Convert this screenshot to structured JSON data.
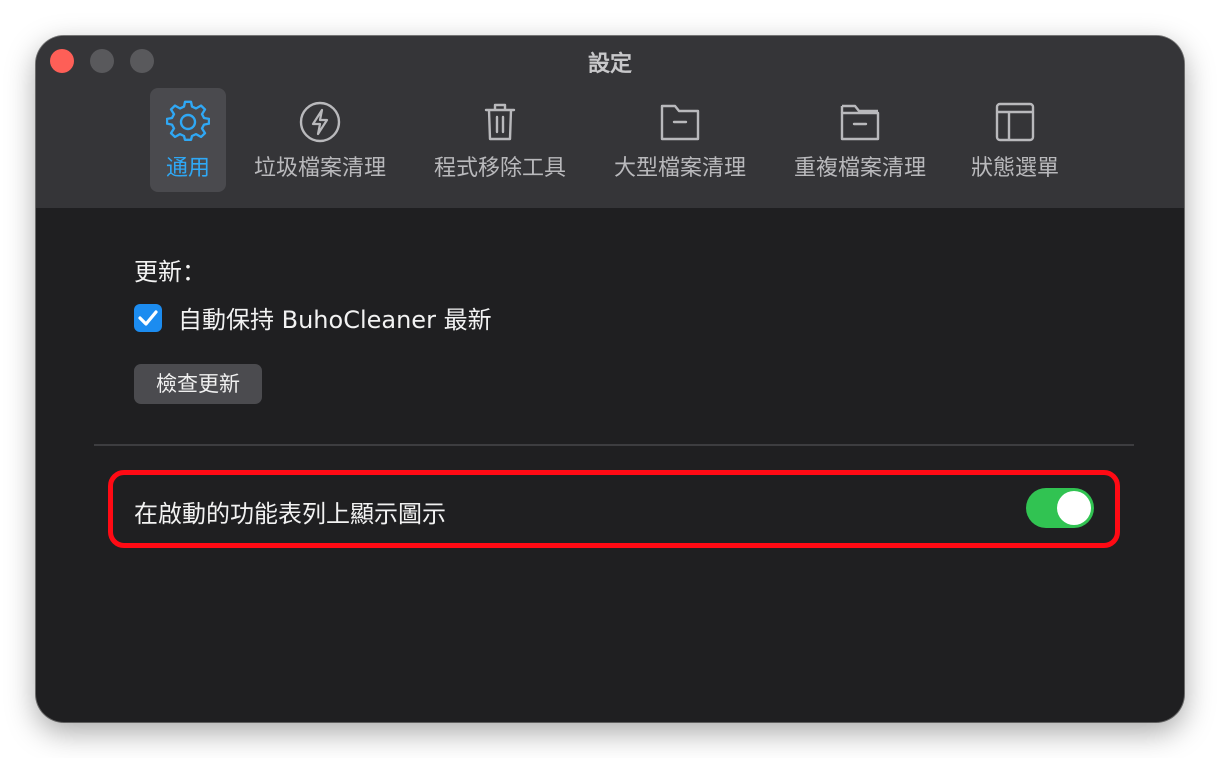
{
  "window": {
    "title": "設定"
  },
  "tabs": [
    {
      "label": "通用",
      "icon": "gear-icon",
      "active": true
    },
    {
      "label": "垃圾檔案清理",
      "icon": "lightning-icon",
      "active": false
    },
    {
      "label": "程式移除工具",
      "icon": "trash-icon",
      "active": false
    },
    {
      "label": "大型檔案清理",
      "icon": "folder-icon",
      "active": false
    },
    {
      "label": "重複檔案清理",
      "icon": "folder-stack-icon",
      "active": false
    },
    {
      "label": "狀態選單",
      "icon": "panel-layout-icon",
      "active": false
    }
  ],
  "update": {
    "section_label": "更新：",
    "auto_update_label": "自動保持 BuhoCleaner 最新",
    "auto_update_checked": true,
    "check_button_label": "檢查更新"
  },
  "menubar": {
    "toggle_label": "在啟動的功能表列上顯示圖示",
    "toggle_on": true
  },
  "colors": {
    "accent": "#2fa8f5",
    "toggle_on": "#31c352",
    "highlight": "#ff0a14",
    "checkbox": "#1c8cf0"
  }
}
